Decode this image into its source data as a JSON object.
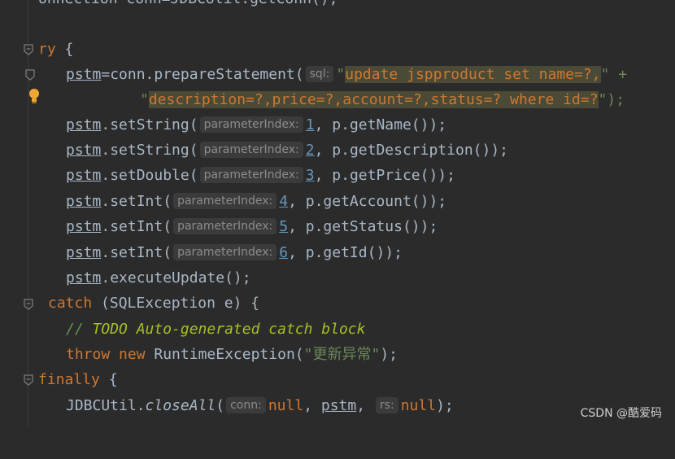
{
  "lines": {
    "l0": "onnection conn=JDBCUtil.getConn();",
    "l1_kw": "ry",
    "l1_rest": " {",
    "l2_var": "pstm",
    "l2_a": "=conn.prepareStatement(",
    "l2_hint": "sql:",
    "l2_q": "\"",
    "l2_hl": "update jspproduct set name=?,",
    "l2_end": "\" +",
    "l3_q": "\"",
    "l3_hl": "description=?,price=?,account=?,status=? where id=?",
    "l3_end": "\");",
    "l4_var": "pstm",
    "l4_a": ".setString(",
    "l4_hint": "parameterIndex:",
    "l4_num": "1",
    "l4_rest": ", p.getName());",
    "l5_var": "pstm",
    "l5_a": ".setString(",
    "l5_hint": "parameterIndex:",
    "l5_num": "2",
    "l5_rest": ", p.getDescription());",
    "l6_var": "pstm",
    "l6_a": ".setDouble(",
    "l6_hint": "parameterIndex:",
    "l6_num": "3",
    "l6_rest": ", p.getPrice());",
    "l7_var": "pstm",
    "l7_a": ".setInt(",
    "l7_hint": "parameterIndex:",
    "l7_num": "4",
    "l7_rest": ", p.getAccount());",
    "l8_var": "pstm",
    "l8_a": ".setInt(",
    "l8_hint": "parameterIndex:",
    "l8_num": "5",
    "l8_rest": ", p.getStatus());",
    "l9_var": "pstm",
    "l9_a": ".setInt(",
    "l9_hint": "parameterIndex:",
    "l9_num": "6",
    "l9_rest": ", p.getId());",
    "l10_var": "pstm",
    "l10_a": ".executeUpdate();",
    "l11_kw": "catch",
    "l11_rest": " (SQLException e) {",
    "l12_cm": "// ",
    "l12_todo": "TODO Auto-generated catch block",
    "l13_kw1": "throw",
    "l13_kw2": "new",
    "l13_a": " RuntimeException(",
    "l13_str": "\"更新异常\"",
    "l13_end": ");",
    "l14_kw": "finally",
    "l14_rest": " {",
    "l15_a": "JDBCUtil.",
    "l15_it": "closeAll",
    "l15_b": "(",
    "l15_hint1": "conn:",
    "l15_null1": "null",
    "l15_c": ", ",
    "l15_var": "pstm",
    "l15_d": ", ",
    "l15_hint2": "rs:",
    "l15_null2": "null",
    "l15_end": ");"
  },
  "watermark": "CSDN @酷爱码",
  "colors": {
    "background": "#2b2b2b",
    "keyword": "#cc7832",
    "text": "#a9b7c6",
    "string": "#6a8759",
    "number": "#6897bb",
    "highlight": "#4b4a36"
  },
  "icons": [
    "fold-icon",
    "bookmark-icon",
    "lightbulb-icon"
  ]
}
